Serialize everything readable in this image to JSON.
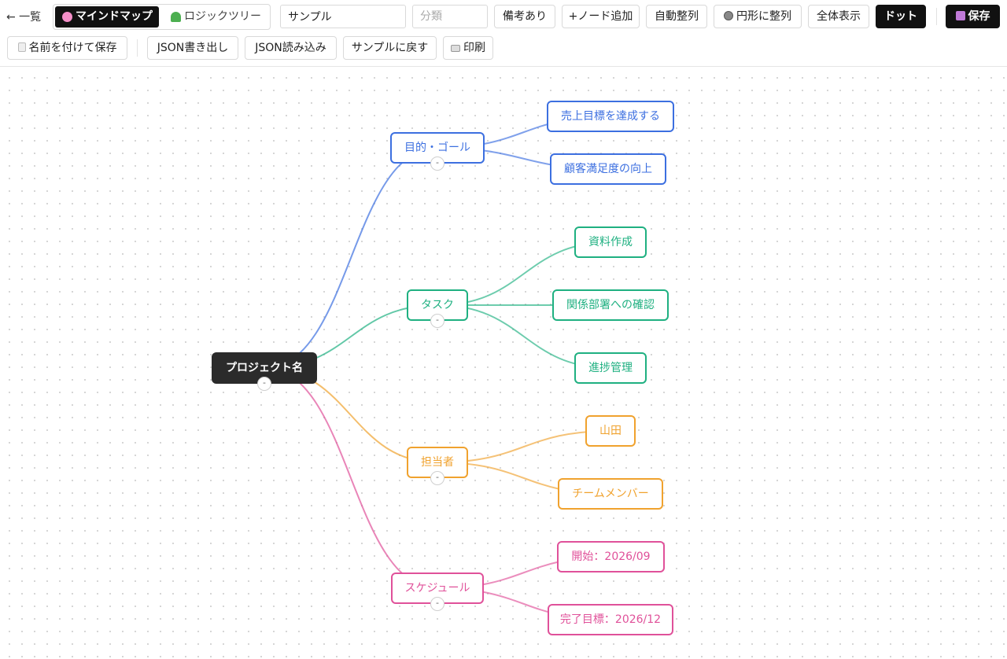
{
  "toolbar": {
    "back_label": "← 一覧",
    "view_mindmap_label": "マインドマップ",
    "view_logictree_label": "ロジックツリー",
    "title_value": "サンプル",
    "category_placeholder": "分類",
    "notes_label": "備考あり",
    "add_node_label": "+ノード追加",
    "auto_arrange_label": "自動整列",
    "circle_arrange_label": "円形に整列",
    "fit_all_label": "全体表示",
    "dot_label": "ドット",
    "save_label": "保存",
    "save_as_label": "名前を付けて保存",
    "json_export_label": "JSON書き出し",
    "json_import_label": "JSON読み込み",
    "reset_sample_label": "サンプルに戻す",
    "print_label": "印刷"
  },
  "icons": {
    "mindmap": "brain-icon",
    "logictree": "tree-icon",
    "circle": "circle-icon",
    "save": "floppy-disk-icon",
    "save_as": "document-icon",
    "print": "printer-icon"
  },
  "colors": {
    "root": "#2b2b2b",
    "goal": "#3c6fe0",
    "task": "#1fb081",
    "owner": "#f0a22e",
    "schedule": "#e0519a"
  },
  "mindmap": {
    "root": {
      "label": "プロジェクト名"
    },
    "branches": [
      {
        "label": "目的・ゴール",
        "color": "#3c6fe0",
        "children": [
          "売上目標を達成する",
          "顧客満足度の向上"
        ]
      },
      {
        "label": "タスク",
        "color": "#1fb081",
        "children": [
          "資料作成",
          "関係部署への確認",
          "進捗管理"
        ]
      },
      {
        "label": "担当者",
        "color": "#f0a22e",
        "children": [
          "山田",
          "チームメンバー"
        ]
      },
      {
        "label": "スケジュール",
        "color": "#e0519a",
        "children": [
          "開始：2026/09",
          "完了目標：2026/12"
        ]
      }
    ],
    "collapse_symbol": "-"
  }
}
